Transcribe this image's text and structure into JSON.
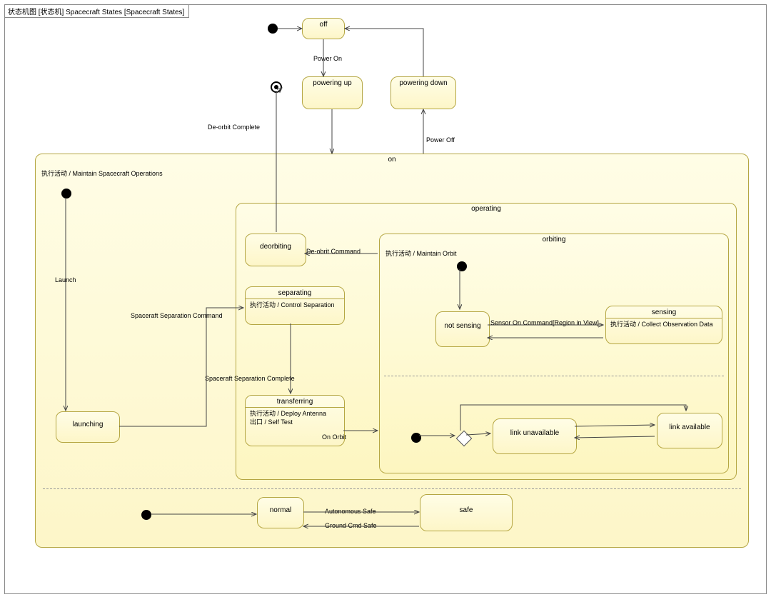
{
  "diagram_title": "状态机图 [状态机] Spacecraft States [Spacecraft States]",
  "states": {
    "off": "off",
    "powering_up": "powering up",
    "powering_down": "powering down",
    "on": "on",
    "on_entry": "执行活动 / Maintain Spacecraft Operations",
    "launching": "launching",
    "operating": "operating",
    "deorbiting": "deorbiting",
    "separating": {
      "title": "separating",
      "body": "执行活动 / Control Separation"
    },
    "transferring": {
      "title": "transferring",
      "body1": "执行活动 / Deploy Antenna",
      "body2": "出口 / Self Test"
    },
    "orbiting": "orbiting",
    "orbiting_entry": "执行活动 / Maintain Orbit",
    "not_sensing": "not sensing",
    "sensing": {
      "title": "sensing",
      "body": "执行活动 / Collect Observation Data"
    },
    "link_unavailable": "link unavailable",
    "link_available": "link available",
    "normal": "normal",
    "safe": "safe"
  },
  "transitions": {
    "power_on": "Power On",
    "power_off": "Power Off",
    "deorbit_complete": "De-orbit Complete",
    "launch": "Launch",
    "spacecraft_separation_command": "Spaceraft Separation Command",
    "spacecraft_separation_complete": "Spaceraft Separation Complete",
    "on_orbit": "On Orbit",
    "deorbit_command": "De-obrit Command",
    "sensor_on": "Sensor On Command[Region in View]",
    "autonomous_safe": "Autonomous Safe",
    "ground_cmd_safe": "Ground Cmd Safe"
  }
}
